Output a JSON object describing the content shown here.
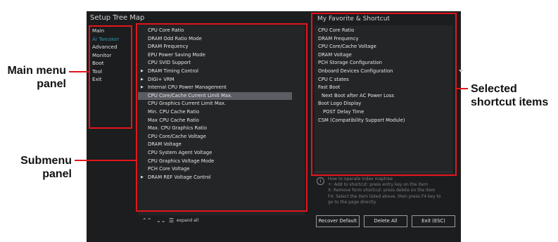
{
  "window": {
    "tree_title": "Setup Tree Map",
    "fav_title": "My Favorite & Shortcut"
  },
  "main_menu": [
    {
      "label": "Main",
      "active": false
    },
    {
      "label": "Ai Tweaker",
      "active": true
    },
    {
      "label": "Advanced",
      "active": false
    },
    {
      "label": "Monitor",
      "active": false
    },
    {
      "label": "Boot",
      "active": false
    },
    {
      "label": "Tool",
      "active": false
    },
    {
      "label": "Exit",
      "active": false
    }
  ],
  "submenu": [
    {
      "label": "CPU Core Ratio"
    },
    {
      "label": "DRAM Odd Ratio Mode"
    },
    {
      "label": "DRAM Frequency"
    },
    {
      "label": "EPU Power Saving Mode"
    },
    {
      "label": "CPU SVID Support"
    },
    {
      "label": "DRAM Timing Control",
      "arrow": true
    },
    {
      "label": "DIGI+ VRM",
      "arrow": true
    },
    {
      "label": "Internal CPU Power Management",
      "arrow": true
    },
    {
      "label": "CPU Core/Cache Current Limit Max.",
      "highlight": true
    },
    {
      "label": "CPU Graphics Current Limit Max."
    },
    {
      "label": "Min. CPU Cache Ratio"
    },
    {
      "label": "Max CPU Cache Ratio"
    },
    {
      "label": "Max. CPU Graphics Ratio"
    },
    {
      "label": "CPU Core/Cache Voltage"
    },
    {
      "label": "DRAM Voltage"
    },
    {
      "label": "CPU System Agent Voltage"
    },
    {
      "label": "CPU Graphics Voltage Mode"
    },
    {
      "label": "PCH Core Voltage"
    },
    {
      "label": "DRAM REF Voltage Control",
      "arrow": true
    }
  ],
  "favorites": [
    {
      "label": "CPU Core Ratio",
      "indent": 0
    },
    {
      "label": "DRAM Frequency",
      "indent": 0
    },
    {
      "label": "CPU Core/Cache Voltage",
      "indent": 0
    },
    {
      "label": "DRAM Voltage",
      "indent": 0
    },
    {
      "label": "PCH Storage Configuration",
      "indent": 0
    },
    {
      "label": "Onboard Devices Configuration",
      "indent": 0
    },
    {
      "label": "CPU C states",
      "indent": 0
    },
    {
      "label": "Fast Boot",
      "indent": 0
    },
    {
      "label": "Next Boot after AC Power Loss",
      "indent": 1
    },
    {
      "label": "Boot Logo Display",
      "indent": 0
    },
    {
      "label": "POST Delay Time",
      "indent": 2
    },
    {
      "label": "CSM (Compatibility Support Module)",
      "indent": 0
    }
  ],
  "info": {
    "icon": "info-icon",
    "lines": [
      "How to operate index maptree",
      "+: Add to shortcut: press entry key on the item",
      "X: Remove form shortcut: press delete on the item",
      "F4: Select the item listed above, then press F4 key to",
      "go to the page directly."
    ]
  },
  "bottom_controls": {
    "collapse_icon": "double-chevron-up-icon",
    "expand_icon": "double-chevron-down-icon",
    "expand_all_icon": "list-icon",
    "expand_all_label": "expand all"
  },
  "buttons": {
    "recover_default": "Recover Default",
    "delete_all": "Delete All",
    "exit": "Exit (ESC)"
  },
  "callouts": {
    "main_menu": "Main menu panel",
    "submenu": "Submenu panel",
    "selected": "Selected shortcut items"
  },
  "colors": {
    "highlight_box": "#e4151b",
    "active_menu": "#2f8fa6",
    "background": "#1b1d1f"
  }
}
